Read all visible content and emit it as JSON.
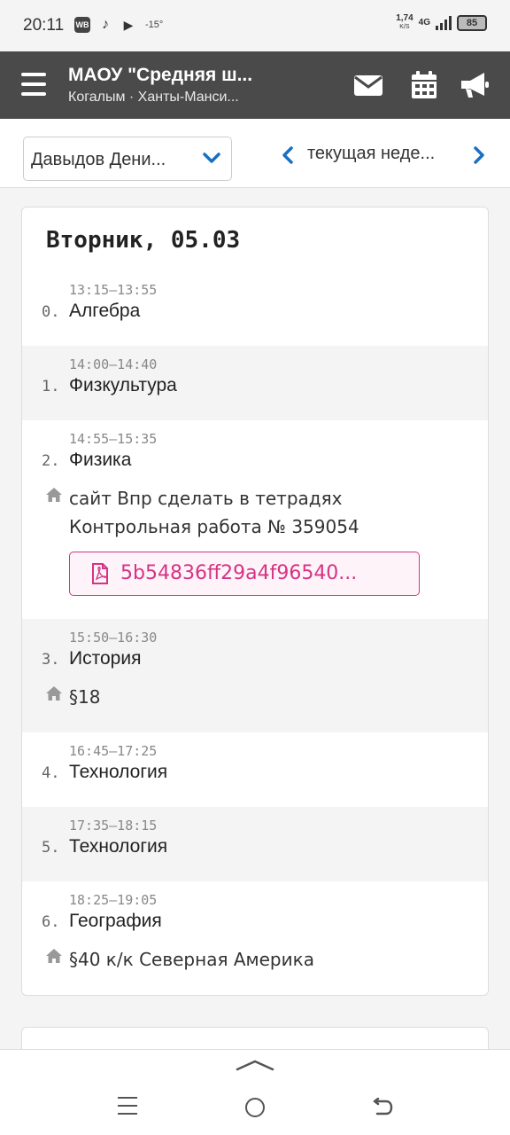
{
  "status_bar": {
    "time": "20:11",
    "app_icons": [
      "WB",
      "♪",
      "▶"
    ],
    "temperature": "-15°",
    "net_speed_value": "1,74",
    "net_speed_unit": "K/S",
    "network": "4G",
    "battery": "85"
  },
  "app_bar": {
    "title": "МАОУ \"Средняя ш...",
    "subtitle": "Когалым · Ханты-Манси...",
    "icons": [
      "menu-icon",
      "mail-icon",
      "calendar-icon",
      "megaphone-icon"
    ]
  },
  "toolbar": {
    "student": "Давыдов Дени...",
    "week_label": "текущая неде..."
  },
  "day": {
    "title": "Вторник, 05.03",
    "lessons": [
      {
        "number": "0.",
        "time": "13:15–13:55",
        "subject": "Алгебра"
      },
      {
        "number": "1.",
        "time": "14:00–14:40",
        "subject": "Физкультура"
      },
      {
        "number": "2.",
        "time": "14:55–15:35",
        "subject": "Физика",
        "homework": "сайт Впр сделать в тетрадях\nКонтрольная работа № 359054",
        "attachment": "5b54836ff29a4f96540..."
      },
      {
        "number": "3.",
        "time": "15:50–16:30",
        "subject": "История",
        "homework": "§18"
      },
      {
        "number": "4.",
        "time": "16:45–17:25",
        "subject": "Технология"
      },
      {
        "number": "5.",
        "time": "17:35–18:15",
        "subject": "Технология"
      },
      {
        "number": "6.",
        "time": "18:25–19:05",
        "subject": "География",
        "homework": "§40 к/к Северная Америка"
      }
    ]
  },
  "colors": {
    "app_bar": "#4a4a4a",
    "accent": "#1a6fc4",
    "attachment": "#d63384"
  }
}
